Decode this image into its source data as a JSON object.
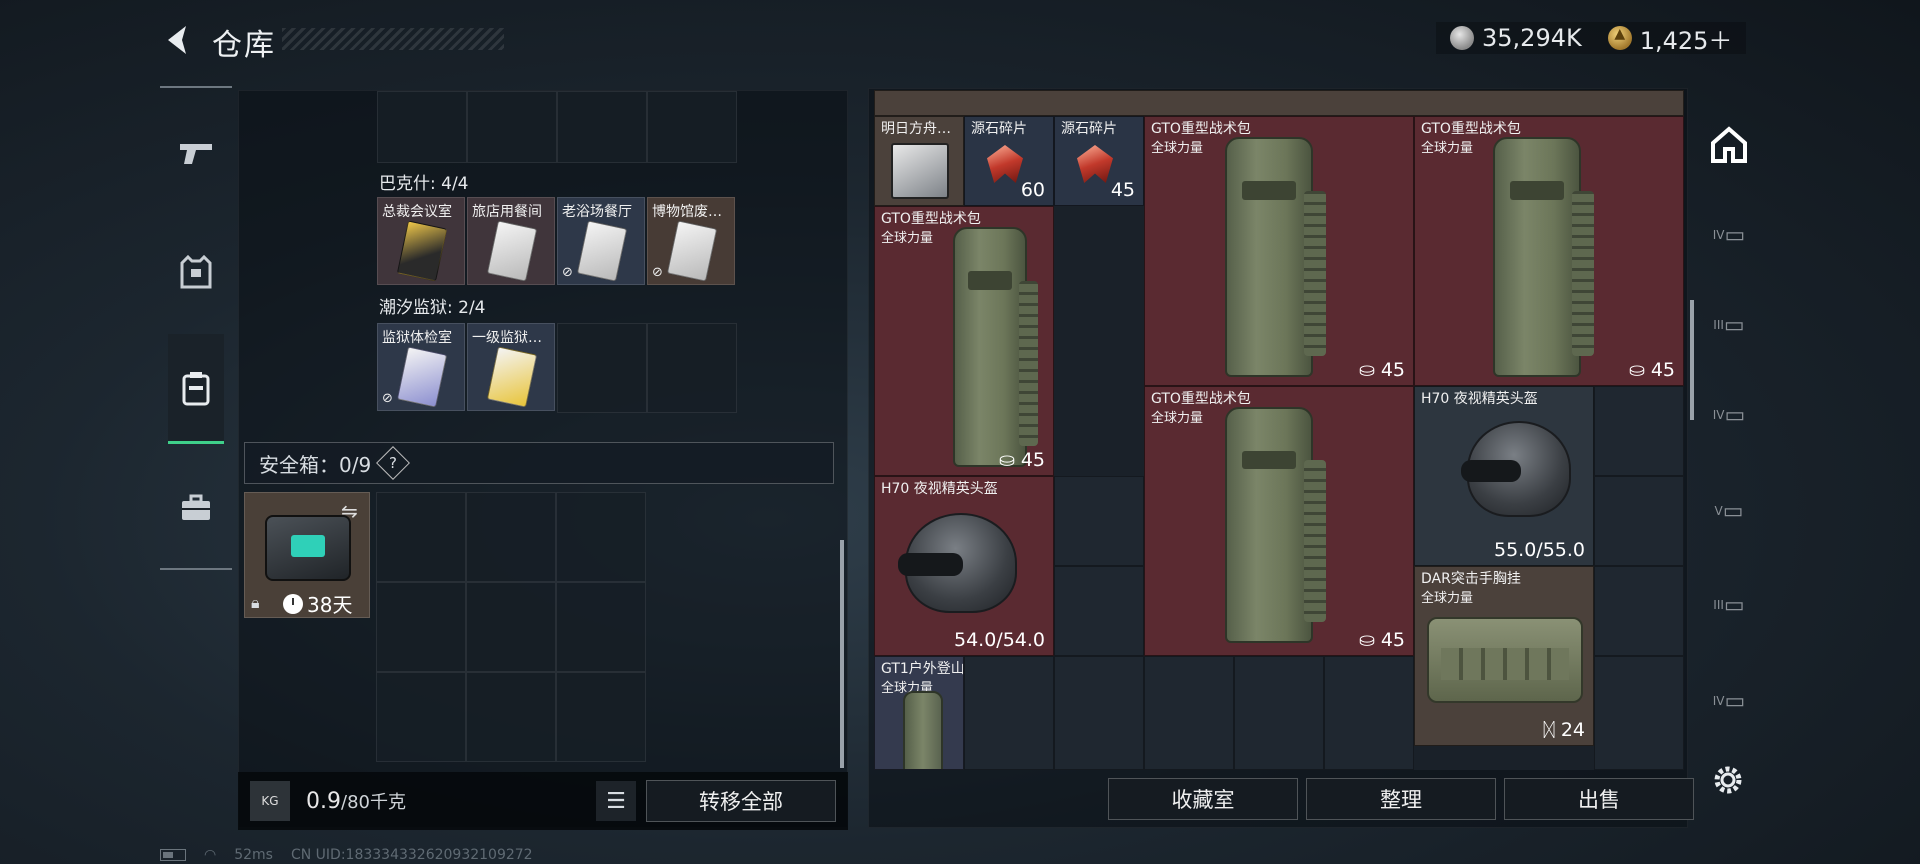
{
  "header": {
    "title": "仓库",
    "back_label": "返回"
  },
  "currency": {
    "coins": "35,294K",
    "tickets": "1,425＋"
  },
  "left_rail": [
    {
      "name": "weapons"
    },
    {
      "name": "equipment"
    },
    {
      "name": "backpack"
    },
    {
      "name": "briefcase"
    }
  ],
  "keycard_sections": [
    {
      "title": "巴克什: 4/4",
      "cards": [
        "总裁会议室",
        "旅店用餐间",
        "老浴场餐厅",
        "博物馆废…"
      ]
    },
    {
      "title": "潮汐监狱: 2/4",
      "cards": [
        "监狱体检室",
        "一级监狱…"
      ]
    }
  ],
  "safebox": {
    "label": "安全箱：0/9",
    "help": "?",
    "timer": "38天"
  },
  "bottom_left": {
    "weight_icon_text": "KG",
    "weight": "0.9",
    "weight_max": "/80千克",
    "transfer_all": "转移全部"
  },
  "stash_items": {
    "card_tomorrow": {
      "name": "明日方舟…"
    },
    "shard1": {
      "name": "源石碎片",
      "qty": "60"
    },
    "shard2": {
      "name": "源石碎片",
      "qty": "45"
    },
    "bag_a": {
      "name": "GTO重型战术包",
      "sub": "全球力量",
      "qty": "45"
    },
    "bag_b": {
      "name": "GTO重型战术包",
      "sub": "全球力量",
      "qty": "45"
    },
    "bag_c": {
      "name": "GTO重型战术包",
      "sub": "全球力量",
      "qty": "45"
    },
    "bag_d": {
      "name": "GTO重型战术包",
      "sub": "全球力量",
      "qty": "45"
    },
    "helmet_a": {
      "name": "H70 夜视精英头盔",
      "durability": "54.0/54.0"
    },
    "helmet_b": {
      "name": "H70 夜视精英头盔",
      "durability": "55.0/55.0"
    },
    "vest": {
      "name": "DAR突击手胸挂",
      "sub": "全球力量",
      "qty": "24"
    },
    "gt1": {
      "name": "GT1户外登山包",
      "sub": "全球力量"
    }
  },
  "right_rail": [
    "IV",
    "III",
    "IV",
    "V",
    "III",
    "IV"
  ],
  "actions": {
    "collection": "收藏室",
    "sort": "整理",
    "sell": "出售"
  },
  "status": {
    "ping": "52ms",
    "uid": "CN UID:18333433262093210927​2"
  }
}
